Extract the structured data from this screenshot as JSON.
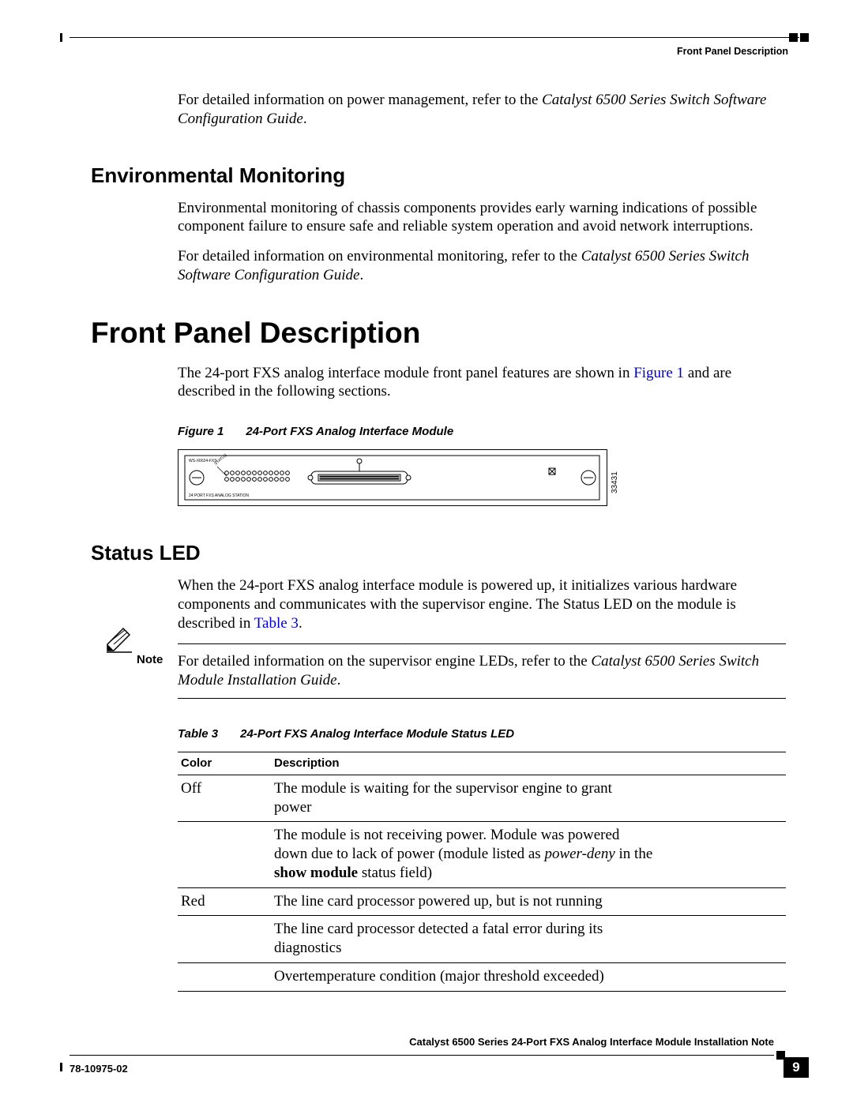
{
  "header": {
    "running_head": "Front Panel Description"
  },
  "intro": {
    "power_ref_prefix": "For detailed information on power management, refer to the ",
    "power_ref_title": "Catalyst 6500 Series Switch Software Configuration Guide",
    "period": "."
  },
  "env": {
    "heading": "Environmental Monitoring",
    "p1": "Environmental monitoring of chassis components provides early warning indications of possible component failure to ensure safe and reliable system operation and avoid network interruptions.",
    "p2_prefix": "For detailed information on environmental monitoring, refer to the ",
    "p2_title": "Catalyst 6500 Series Switch Software Configuration Guide",
    "p2_period": "."
  },
  "front_panel": {
    "heading": "Front Panel Description",
    "p_prefix": "The 24-port FXS analog interface module front panel features are shown in ",
    "p_link": "Figure 1",
    "p_suffix": " and are described in the following sections.",
    "fig_lead": "Figure 1",
    "fig_title": "24-Port FXS Analog Interface Module",
    "fig_id": "33431",
    "fig_label_top": "WS-X6624-FXS",
    "fig_label_bottom": "24 PORT FXS ANALOG STATION"
  },
  "status_led": {
    "heading": "Status LED",
    "p_prefix": "When the 24-port FXS analog interface module is powered up, it initializes various hardware components and communicates with the supervisor engine. The Status LED on the module is described in ",
    "p_link": "Table 3",
    "p_period": ".",
    "note_label": "Note",
    "note_prefix": "For detailed information on the supervisor engine LEDs, refer to the ",
    "note_title": "Catalyst 6500 Series Switch Module Installation Guide",
    "note_period": ".",
    "table_lead": "Table 3",
    "table_title": "24-Port FXS Analog Interface Module Status LED",
    "th_color": "Color",
    "th_desc": "Description",
    "rows": [
      {
        "color": "Off",
        "desc_pre": "The module is waiting for the supervisor engine to grant power",
        "desc_ital": "",
        "desc_post": ""
      },
      {
        "color": "",
        "desc_pre": "The module is not receiving power. Module was powered down due to lack of power (module listed as ",
        "desc_ital": "power-deny",
        "desc_post": " in the ",
        "desc_bold": "show module",
        "desc_tail": " status field)"
      },
      {
        "color": "Red",
        "desc_pre": "The line card processor powered up, but is not running",
        "desc_ital": "",
        "desc_post": ""
      },
      {
        "color": "",
        "desc_pre": "The line card processor detected a fatal error during its diagnostics",
        "desc_ital": "",
        "desc_post": ""
      },
      {
        "color": "",
        "desc_pre": "Overtemperature condition (major threshold exceeded)",
        "desc_ital": "",
        "desc_post": ""
      }
    ]
  },
  "footer": {
    "doc_title": "Catalyst 6500 Series 24-Port FXS Analog Interface Module Installation Note",
    "doc_num": "78-10975-02",
    "page": "9"
  }
}
